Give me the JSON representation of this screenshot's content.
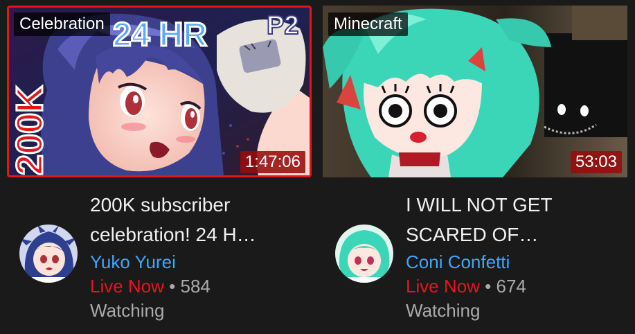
{
  "videos": [
    {
      "tag": "Celebration",
      "duration": "1:47:06",
      "title_line1": "200K subscriber",
      "title_line2": "celebration! 24 H…",
      "channel": "Yuko Yurei",
      "live_label": "Live Now",
      "separator": "•",
      "viewers": "584",
      "watching_label": "Watching",
      "thumb_text_top": "P2",
      "thumb_text_side": "200K",
      "thumb_text_hr": "24 HR"
    },
    {
      "tag": "Minecraft",
      "duration": "53:03",
      "title_line1": "I WILL NOT GET",
      "title_line2": "SCARED OF…",
      "channel": "Coni Confetti",
      "live_label": "Live Now",
      "separator": "•",
      "viewers": "674",
      "watching_label": "Watching"
    }
  ],
  "colors": {
    "background": "#1a1a1a",
    "live": "#e8141b",
    "channel_link": "#3ea6ff",
    "live_border": "#e0161a"
  },
  "icons": {
    "avatar_1": "avatar-yuko-yurei",
    "avatar_2": "avatar-coni-confetti"
  }
}
